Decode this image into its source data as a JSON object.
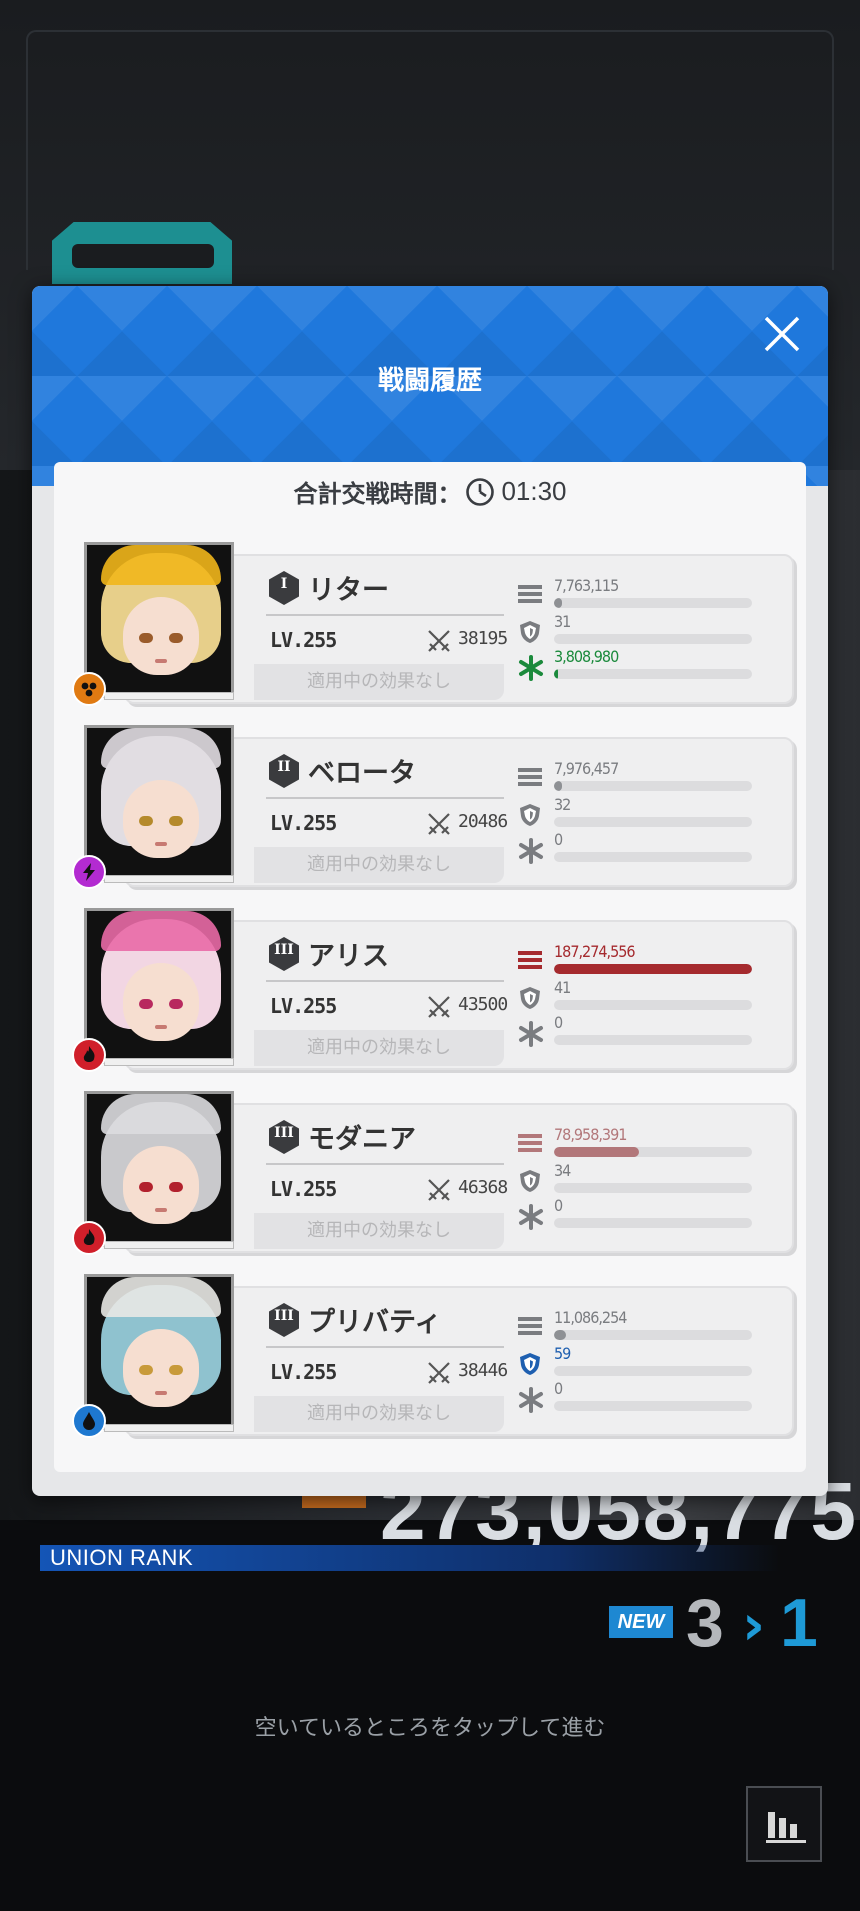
{
  "modal": {
    "title": "戦闘履歴",
    "duration_label": "合計交戦時間：",
    "duration_value": "01:30"
  },
  "characters": [
    {
      "rank": "I",
      "name": "リター",
      "level": "LV.255",
      "power": "38195",
      "effect": "適用中の効果なし",
      "element": "burst-hex-icon",
      "element_color": "#e07a12",
      "stats": {
        "damage": {
          "value": "7,763,115",
          "fraction": 0.04,
          "color": "#8e9094",
          "highlight": false
        },
        "damage_taken": {
          "value": "31",
          "fraction": 0.0,
          "color": "#8e9094"
        },
        "heal": {
          "value": "3,808,980",
          "fraction": 0.02,
          "color": "#1b8a3c",
          "highlight": true
        }
      },
      "hair": "#e7cf8a",
      "hat": "#f1b61b",
      "eyes": "#9a5b2a"
    },
    {
      "rank": "II",
      "name": "ベロータ",
      "level": "LV.255",
      "power": "20486",
      "effect": "適用中の効果なし",
      "element": "lightning-icon",
      "element_color": "#b32bd1",
      "stats": {
        "damage": {
          "value": "7,976,457",
          "fraction": 0.04,
          "color": "#8e9094",
          "highlight": false
        },
        "damage_taken": {
          "value": "32",
          "fraction": 0.0,
          "color": "#8e9094"
        },
        "heal": {
          "value": "0",
          "fraction": 0.0,
          "color": "#8e9094",
          "highlight": false
        }
      },
      "hair": "#e1dde2",
      "hat": "#e1dde2",
      "eyes": "#b58a2b"
    },
    {
      "rank": "III",
      "name": "アリス",
      "level": "LV.255",
      "power": "43500",
      "effect": "適用中の効果なし",
      "element": "fire-icon",
      "element_color": "#d01f2a",
      "stats": {
        "damage": {
          "value": "187,274,556",
          "fraction": 1.0,
          "color": "#a52a2e",
          "highlight": true
        },
        "damage_taken": {
          "value": "41",
          "fraction": 0.0,
          "color": "#8e9094"
        },
        "heal": {
          "value": "0",
          "fraction": 0.0,
          "color": "#8e9094",
          "highlight": false
        }
      },
      "hair": "#f2d6e3",
      "hat": "#e96aa6",
      "eyes": "#b8295f"
    },
    {
      "rank": "III",
      "name": "モダニア",
      "level": "LV.255",
      "power": "46368",
      "effect": "適用中の効果なし",
      "element": "fire-icon",
      "element_color": "#d01f2a",
      "stats": {
        "damage": {
          "value": "78,958,391",
          "fraction": 0.43,
          "color": "#b2777a",
          "highlight": true
        },
        "damage_taken": {
          "value": "34",
          "fraction": 0.0,
          "color": "#8e9094"
        },
        "heal": {
          "value": "0",
          "fraction": 0.0,
          "color": "#8e9094",
          "highlight": false
        }
      },
      "hair": "#c9c9cc",
      "hat": "#dcdcdf",
      "eyes": "#b2212d"
    },
    {
      "rank": "III",
      "name": "プリバティ",
      "level": "LV.255",
      "power": "38446",
      "effect": "適用中の効果なし",
      "element": "water-icon",
      "element_color": "#1e78d0",
      "stats": {
        "damage": {
          "value": "11,086,254",
          "fraction": 0.06,
          "color": "#8e9094",
          "highlight": false
        },
        "damage_taken": {
          "value": "59",
          "fraction": 0.0,
          "color": "#1e5fb0",
          "highlight": true
        },
        "heal": {
          "value": "0",
          "fraction": 0.0,
          "color": "#8e9094",
          "highlight": false
        }
      },
      "hair": "#8fc2cf",
      "hat": "#e8e8e4",
      "eyes": "#c89a3a"
    }
  ],
  "background": {
    "score": "273,058,775",
    "union_rank_label": "UNION RANK",
    "new_badge": "NEW",
    "rank_old": "3",
    "rank_new": "1",
    "tap_hint": "空いているところをタップして進む"
  }
}
